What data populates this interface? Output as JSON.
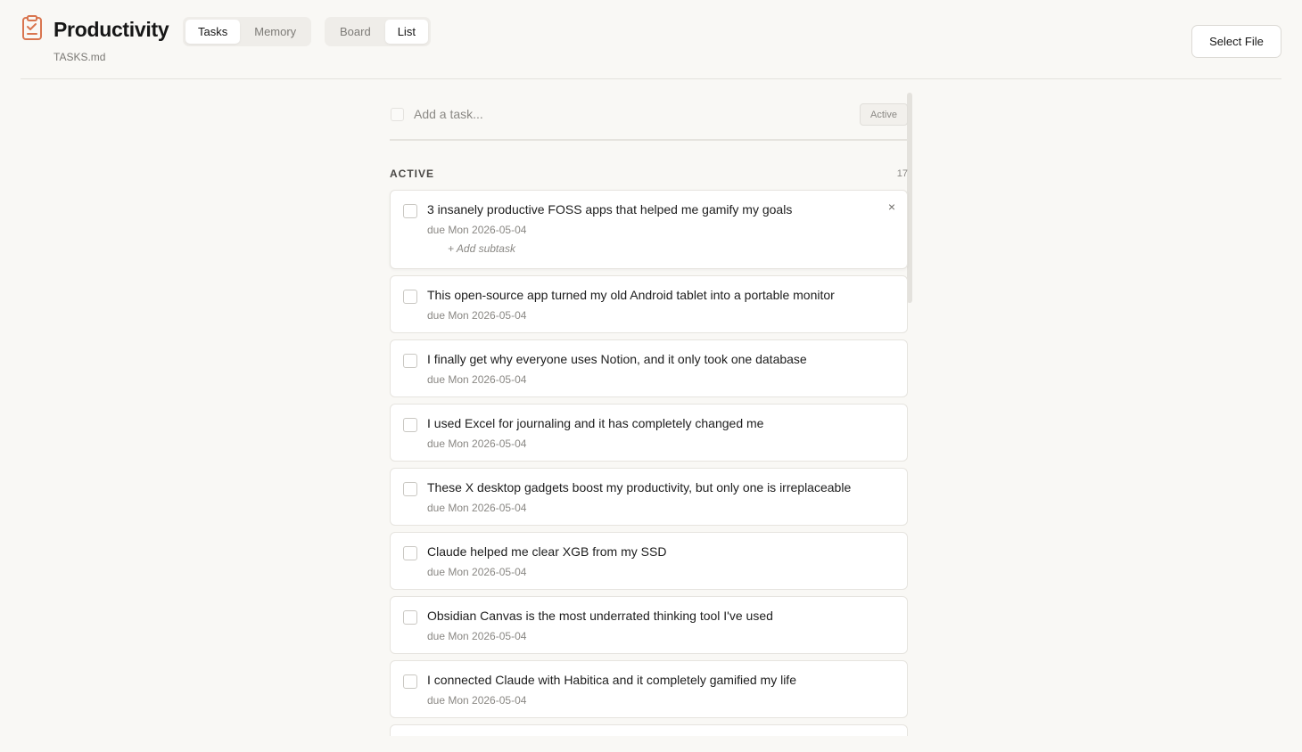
{
  "header": {
    "title": "Productivity",
    "file": "TASKS.md",
    "icon": "clipboard-check-icon",
    "accent_color": "#d9754f",
    "mode_tabs": [
      {
        "label": "Tasks",
        "active": true
      },
      {
        "label": "Memory",
        "active": false
      }
    ],
    "view_tabs": [
      {
        "label": "Board",
        "active": false
      },
      {
        "label": "List",
        "active": true
      }
    ],
    "select_file_label": "Select File"
  },
  "add_task": {
    "placeholder": "Add a task...",
    "status": "Active"
  },
  "section": {
    "title": "ACTIVE",
    "count": "17"
  },
  "tasks": [
    {
      "title": "3 insanely productive FOSS apps that helped me gamify my goals",
      "due": "due Mon 2026-05-04",
      "subtask": "+ Add subtask",
      "close": "×"
    },
    {
      "title": "This open-source app turned my old Android tablet into a portable monitor",
      "due": "due Mon 2026-05-04"
    },
    {
      "title": "I finally get why everyone uses Notion, and it only took one database",
      "due": "due Mon 2026-05-04"
    },
    {
      "title": "I used Excel for journaling and it has completely changed me",
      "due": "due Mon 2026-05-04"
    },
    {
      "title": "These X desktop gadgets boost my productivity, but only one is irreplaceable",
      "due": "due Mon 2026-05-04"
    },
    {
      "title": "Claude helped me clear XGB from my SSD",
      "due": "due Mon 2026-05-04"
    },
    {
      "title": "Obsidian Canvas is the most underrated thinking tool I've used",
      "due": "due Mon 2026-05-04"
    },
    {
      "title": "I connected Claude with Habitica and it completely gamified my life",
      "due": "due Mon 2026-05-04"
    }
  ]
}
